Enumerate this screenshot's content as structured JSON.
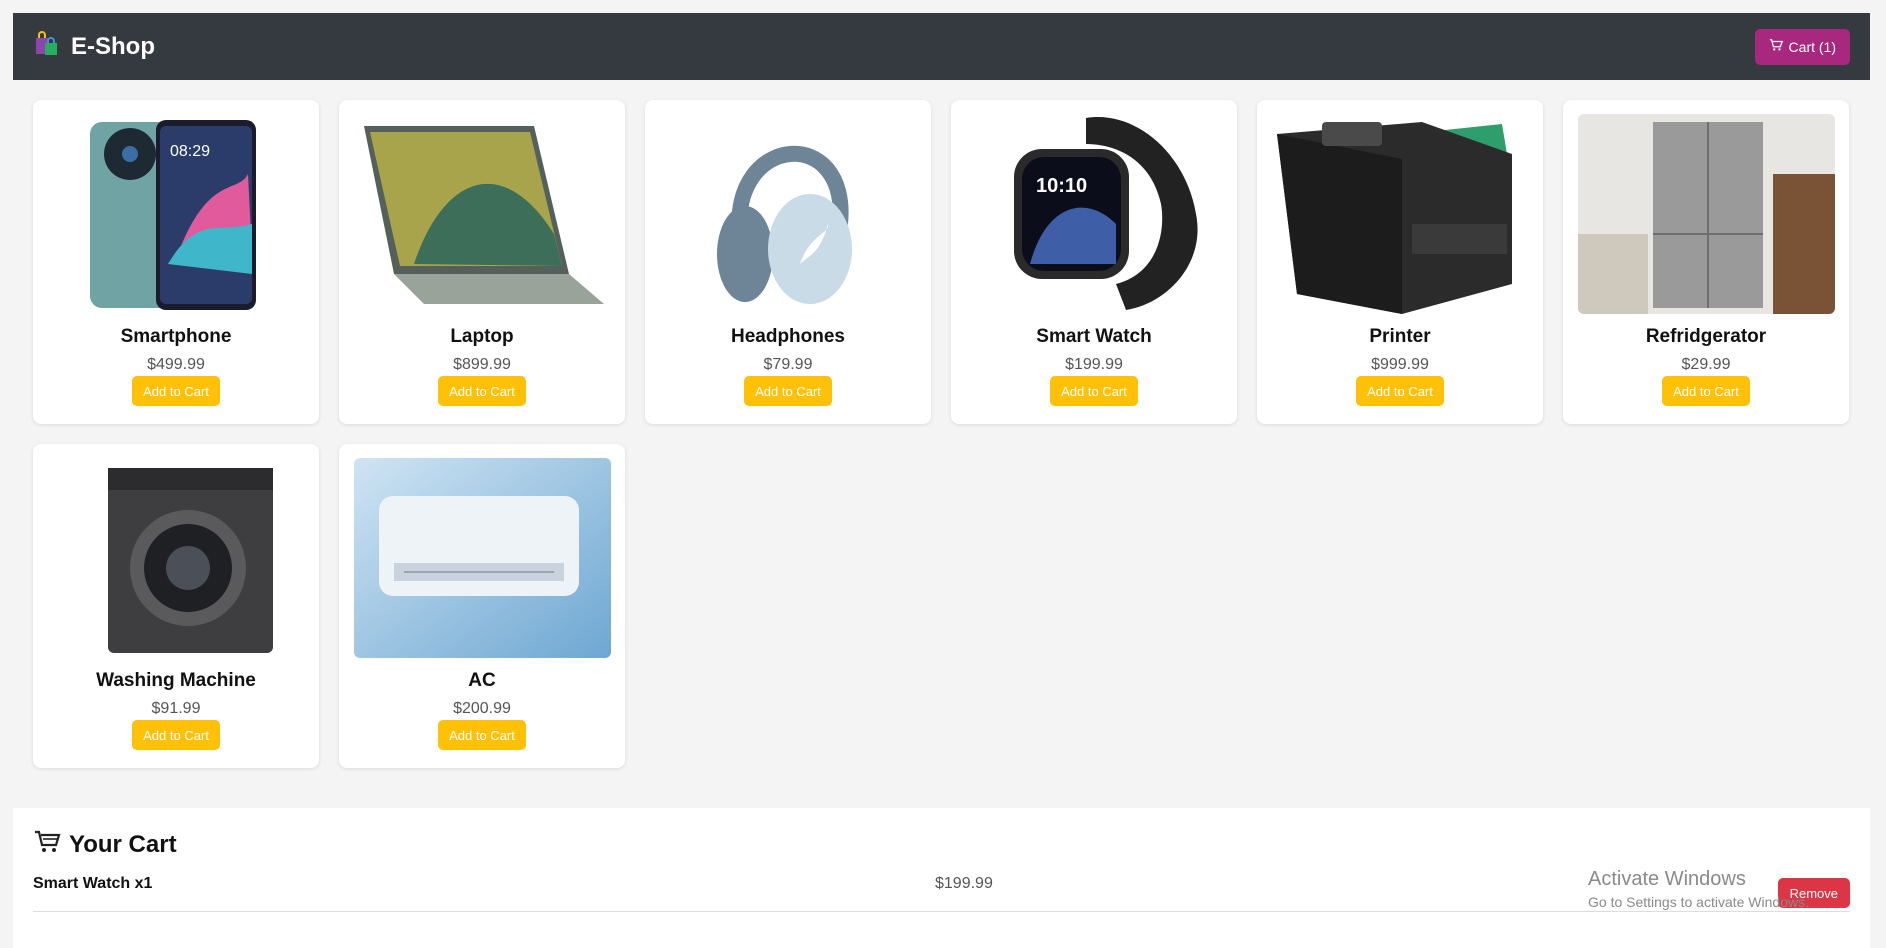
{
  "header": {
    "title": "E-Shop",
    "logo_icon": "shopping-bags-icon",
    "cart_button_label": "Cart (1)",
    "cart_icon": "cart-icon",
    "bg_color": "#343a40",
    "cart_button_color": "#a8277f"
  },
  "products": [
    {
      "name": "Smartphone",
      "price": "$499.99",
      "button": "Add to Cart",
      "image": "smartphone"
    },
    {
      "name": "Laptop",
      "price": "$899.99",
      "button": "Add to Cart",
      "image": "laptop"
    },
    {
      "name": "Headphones",
      "price": "$79.99",
      "button": "Add to Cart",
      "image": "headphones"
    },
    {
      "name": "Smart Watch",
      "price": "$199.99",
      "button": "Add to Cart",
      "image": "smartwatch"
    },
    {
      "name": "Printer",
      "price": "$999.99",
      "button": "Add to Cart",
      "image": "printer"
    },
    {
      "name": "Refridgerator",
      "price": "$29.99",
      "button": "Add to Cart",
      "image": "refrigerator"
    },
    {
      "name": "Washing Machine",
      "price": "$91.99",
      "button": "Add to Cart",
      "image": "washing-machine"
    },
    {
      "name": "AC",
      "price": "$200.99",
      "button": "Add to Cart",
      "image": "air-conditioner"
    }
  ],
  "add_button_color": "#ffc107",
  "cart": {
    "title": "Your Cart",
    "icon": "cart-icon",
    "items": [
      {
        "name": "Smart Watch x1",
        "price": "$199.99",
        "remove_label": "Remove"
      }
    ],
    "remove_button_color": "#dc3545"
  },
  "watermark": {
    "line1": "Activate Windows",
    "line2": "Go to Settings to activate Windows."
  }
}
